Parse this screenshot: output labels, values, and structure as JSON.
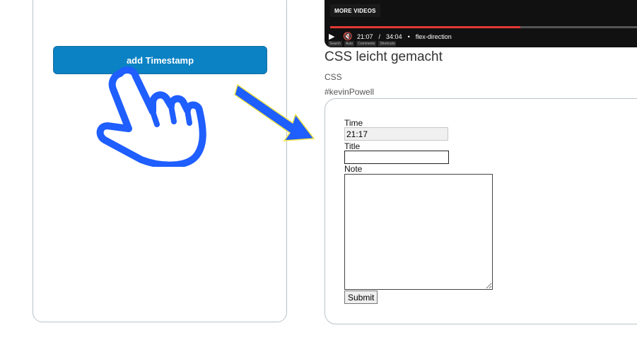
{
  "left_panel": {
    "add_timestamp_label": "add Timestamp"
  },
  "video": {
    "more_videos_label": "MORE VIDEOS",
    "current_time": "21:07",
    "duration": "34:04",
    "chapter": "flex-direction",
    "progress_fraction": 0.62,
    "player_labels": [
      "Search",
      "Auto",
      "Comments",
      "Shortcuts"
    ]
  },
  "info": {
    "title": "CSS leicht gemacht",
    "tag1": "CSS",
    "tag2": "#kevinPowell"
  },
  "form": {
    "time_label": "Time",
    "time_value": "21:17",
    "title_label": "Title",
    "note_label": "Note",
    "submit_label": "Submit"
  },
  "colors": {
    "accent": "#0a82c4",
    "pointer_blue": "#1f5eff",
    "arrow_border": "#f4e54a",
    "progress_red": "#e53935"
  },
  "icons": [
    "pointing-hand-icon",
    "diagonal-arrow-icon",
    "play-icon",
    "mute-icon"
  ]
}
